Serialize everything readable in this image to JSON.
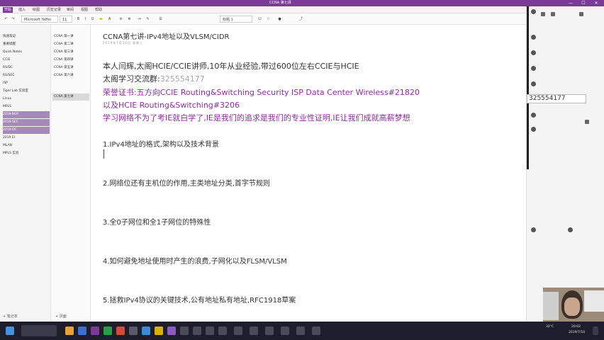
{
  "window": {
    "title": "CCNA 第七讲",
    "controls": [
      "—",
      "☐",
      "✕"
    ]
  },
  "ribbon": {
    "tabs": [
      "开始",
      "插入",
      "绘图",
      "历史记录",
      "审阅",
      "视图",
      "帮助"
    ],
    "active_index": 0
  },
  "toolbar": {
    "font_name": "Microsoft YaHei",
    "font_size": "11",
    "style": "标题 1"
  },
  "notebooks": {
    "items": [
      "快速笔记",
      "重要提醒",
      "Quick Notes",
      "CCIE",
      "RS/DC",
      "RS/SEC",
      "ISP",
      "Tiger Lab 实验室",
      "Linux",
      "MPLS",
      "2019-BGP",
      "2019-SEC",
      "2019-DC",
      "2019 EI",
      "MLAN",
      "MPLS 实验"
    ],
    "highlighted": [
      4,
      5,
      6,
      12
    ]
  },
  "sections": {
    "items": [
      "CCNA 第一讲",
      "CCNA 第二讲",
      "CCNA 第三讲",
      "CCNA 第四讲",
      "CCNA 第五讲",
      "CCNA 第六讲",
      "CCNA 第七讲"
    ],
    "active_index": 6
  },
  "footer": {
    "add_notebook": "+ 笔记本",
    "add_page": "+ 页面"
  },
  "page": {
    "title": "CCNA第七讲-IPv4地址以及VLSM/CIDR",
    "date": "2019年7月10日 星期三",
    "intro": [
      {
        "text": "本人闫辉,太阁HCIE/CCIE讲师,10年从业经验,带过600位左右CCIE与HCIE",
        "color": "dark"
      },
      {
        "text_a": "太阁学习交流群:",
        "text_b": "325554177",
        "color": "mixed"
      },
      {
        "text": "荣誉证书:五方向CCIE Routing&Switching Security ISP Data Center Wireless#21820",
        "color": "purple"
      },
      {
        "text": "以及HCIE Routing&Switching#3206",
        "color": "purple"
      },
      {
        "text": "学习网络不为了考IE就白学了,IE是我们的追求是我们的专业性证明,IE让我们成就高薪梦想",
        "color": "purple"
      }
    ],
    "outline": [
      "1.IPv4地址的格式,架构以及技术背景",
      "2.网络位还有主机位的作用,主类地址分类,首字节规则",
      "3.全0子网位和全1子网位的特殊性",
      "4.如何避免地址使用时产生的浪费,子网化以及FLSM/VLSM",
      "5.拯救IPv4协议的关键技术,公有地址私有地址,RFC1918草案"
    ]
  },
  "right_panel": {
    "group_number": "325554177"
  },
  "taskbar": {
    "tray_weather": "32°C",
    "tray_time": "20:02",
    "tray_date": "2019/7/10"
  }
}
